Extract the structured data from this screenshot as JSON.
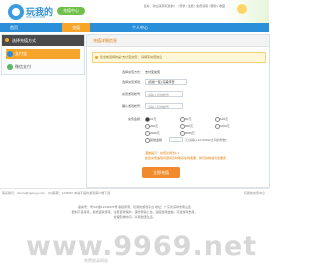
{
  "header": {
    "logo_text": "玩我的",
    "logo_sub": "WANG.COM",
    "pill_label": "充值中心",
    "links": "您好，欢迎来到玩我的！ | 登录 | 注册 | 免费领取 | 帮助 | 收藏"
  },
  "nav": {
    "items": [
      {
        "label": "首页"
      },
      {
        "label": "充值"
      },
      {
        "label": "个人中心"
      }
    ]
  },
  "sidebar": {
    "title": "选择充值方式",
    "items": [
      {
        "label": "支付宝"
      },
      {
        "label": "微信支付"
      }
    ]
  },
  "main": {
    "title": "充值详细信息",
    "info": "您当前选择的是\"支付宝充值\"，请填写充值信息",
    "fields": {
      "method_label": "选择充值方式：",
      "method_value": "支付宝充值",
      "game_label": "选择充值游戏：",
      "game_value": "[双线一区] 完美传奇",
      "account_label": "充值游戏帐号：",
      "account_placeholder": "请输入您的帐号",
      "confirm_label": "确认游戏帐号：",
      "confirm_placeholder": "请输入您的帐号",
      "amount_label": "充值金额：",
      "amount_options": [
        "10元",
        "50元",
        "100元",
        "200元",
        "500元",
        "1000元",
        "2000元",
        "5000元",
        "其他金额"
      ],
      "amount_hint": "元(请输入10-50000之间的整数)"
    },
    "notice_1": "温馨提示：充值比例为1:1",
    "notice_2": "如您充值遇到问题请及时联系在线客服，我们将竭诚为您服务",
    "submit_label": "立即充值"
  },
  "footer": {
    "bar_left": "联系我们：tianxia@qqwyyy.com，QQ客服：1234567  本站不提供游戏客户端下载",
    "bar_right": "玩我的充值中心",
    "line_1": "备案号：粤ICP备12345678号  版权所有：玩我的游戏平台  地址：广东省深圳市南山区",
    "line_2": "抵制不良游戏，拒绝盗版游戏。注意自我保护，谨防受骗上当。适度游戏益脑，沉迷游戏伤身。",
    "line_3": "合理安排时间，享受健康生活。"
  },
  "watermark": {
    "text": "www.9969.net",
    "sub": "免费收录网站"
  },
  "colors": {
    "nav": "#2a8fd8",
    "accent": "#f6a52a",
    "submit": "#f08a2c",
    "brand": "#2f8fd0"
  }
}
